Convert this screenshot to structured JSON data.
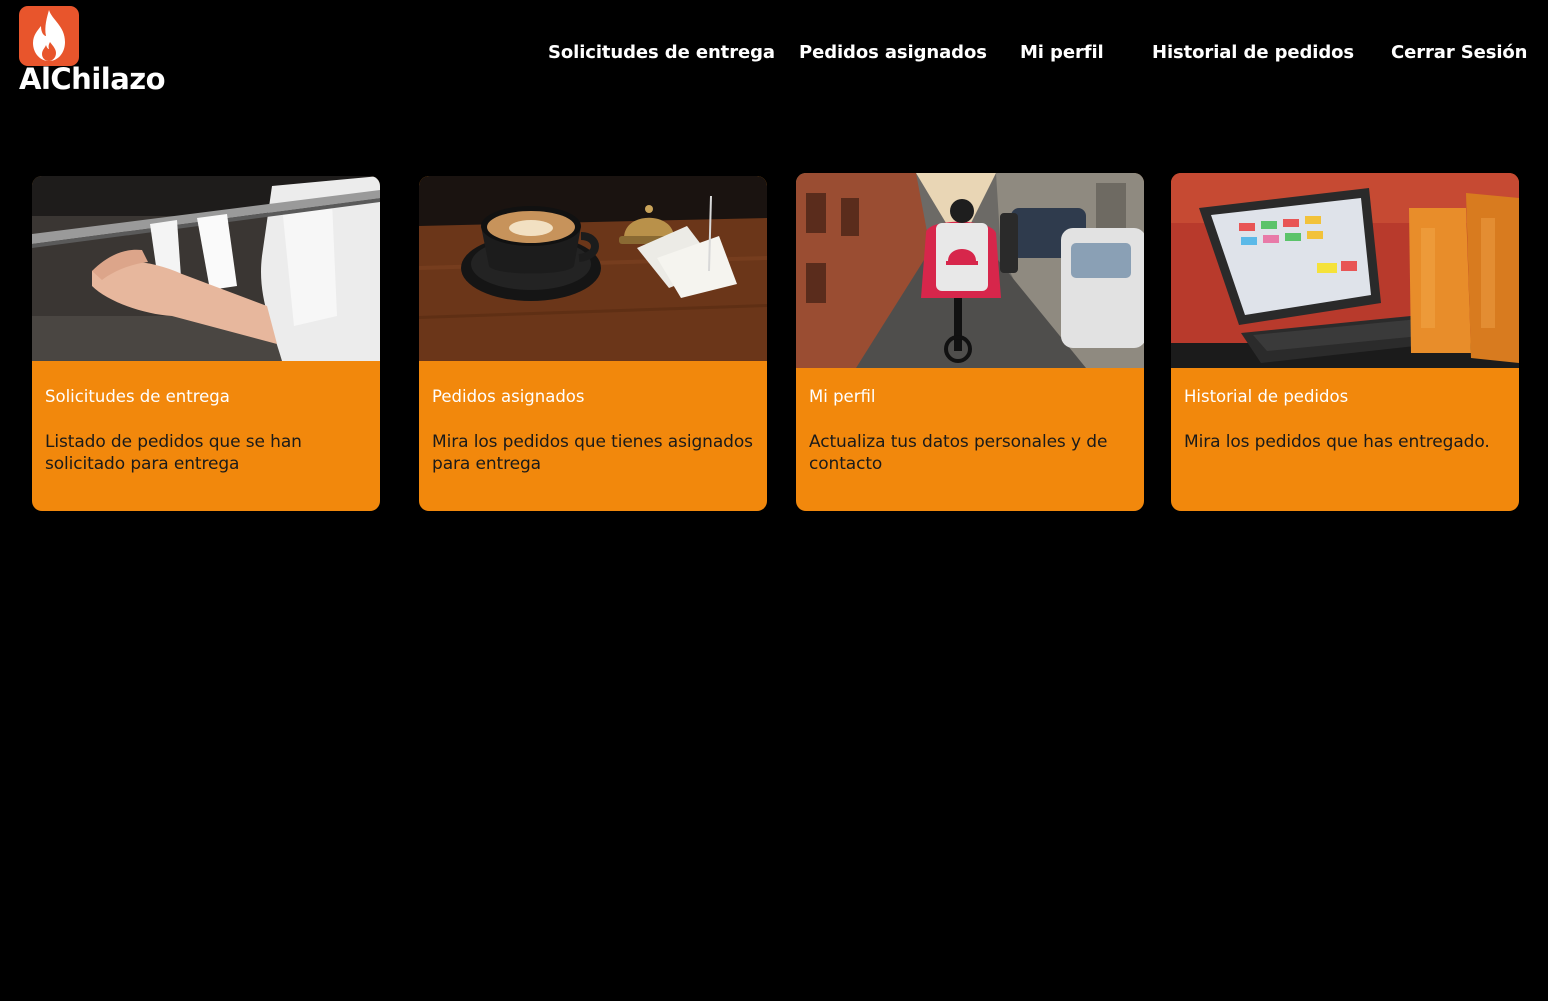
{
  "header": {
    "brand": "AlChilazo",
    "nav": [
      {
        "label": "Solicitudes de entrega"
      },
      {
        "label": "Pedidos asignados"
      },
      {
        "label": "Mi perfil"
      },
      {
        "label": "Historial de pedidos"
      },
      {
        "label": "Cerrar Sesión"
      }
    ]
  },
  "cards": [
    {
      "title": "Solicitudes de entrega",
      "description": "Listado de pedidos que se han solicitado para entrega",
      "image": "kitchen-order-tickets-photo"
    },
    {
      "title": "Pedidos asignados",
      "description": "Mira los pedidos que tienes asignados para entrega",
      "image": "coffee-and-bell-photo"
    },
    {
      "title": "Mi perfil",
      "description": "Actualiza tus datos personales y de contacto",
      "image": "delivery-rider-photo"
    },
    {
      "title": "Historial de pedidos",
      "description": "Mira los pedidos que has entregado.",
      "image": "pos-terminal-photo"
    }
  ],
  "colors": {
    "background": "#000000",
    "card": "#f2880c",
    "logo": "#e8552c",
    "text_light": "#ffffff",
    "text_dark": "#1a1a1a"
  }
}
